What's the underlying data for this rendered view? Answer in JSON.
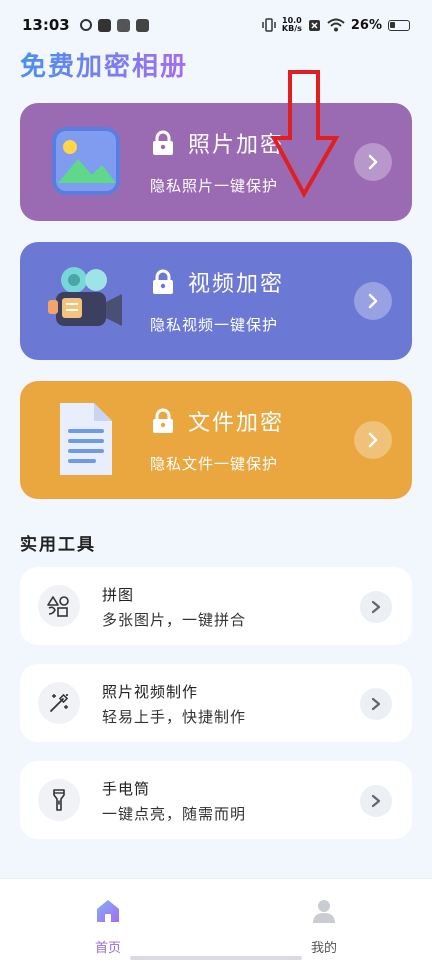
{
  "status_bar": {
    "time": "13:03",
    "net_speed_value": "10.0",
    "net_speed_unit": "KB/s",
    "battery": "26%"
  },
  "app": {
    "title": "免费加密相册"
  },
  "cards": [
    {
      "title": "照片加密",
      "subtitle": "隐私照片一键保护",
      "color": "#9a6bb3"
    },
    {
      "title": "视频加密",
      "subtitle": "隐私视频一键保护",
      "color": "#6c79d4"
    },
    {
      "title": "文件加密",
      "subtitle": "隐私文件一键保护",
      "color": "#eaa63f"
    }
  ],
  "tools_section": {
    "title": "实用工具",
    "items": [
      {
        "title": "拼图",
        "subtitle": "多张图片，一键拼合",
        "icon": "shapes-icon"
      },
      {
        "title": "照片视频制作",
        "subtitle": "轻易上手，快捷制作",
        "icon": "magic-wand-icon"
      },
      {
        "title": "手电筒",
        "subtitle": "一键点亮，随需而明",
        "icon": "flashlight-icon"
      }
    ]
  },
  "bottom_nav": {
    "items": [
      {
        "label": "首页",
        "active": true
      },
      {
        "label": "我的",
        "active": false
      }
    ]
  },
  "colors": {
    "accent": "#9a6bd7",
    "annotation_arrow": "#e02020"
  }
}
